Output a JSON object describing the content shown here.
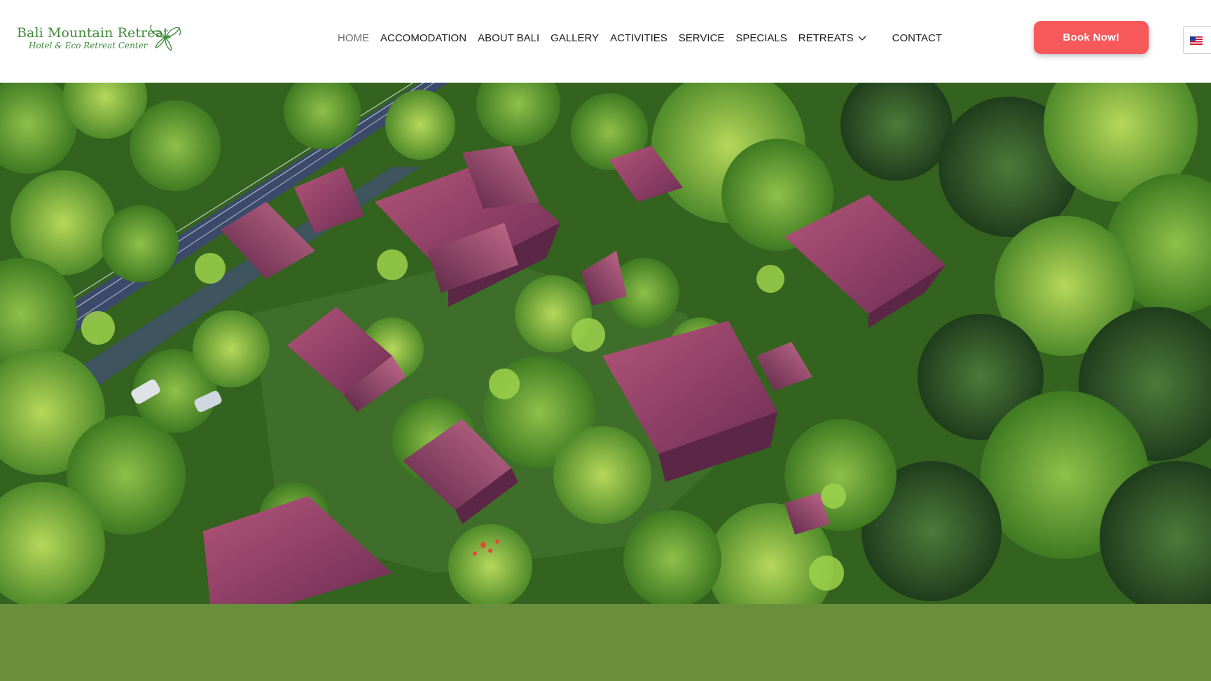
{
  "brand": {
    "name": "Bali Mountain Retreat",
    "tagline": "Hotel & Eco Retreat Center",
    "logo_icon": "orchid-icon",
    "color": "#3e8b3a"
  },
  "nav": {
    "items": [
      {
        "label": "HOME",
        "active": true
      },
      {
        "label": "ACCOMODATION"
      },
      {
        "label": "ABOUT BALI"
      },
      {
        "label": "GALLERY"
      },
      {
        "label": "ACTIVITIES"
      },
      {
        "label": "SERVICE"
      },
      {
        "label": "SPECIALS"
      },
      {
        "label": "RETREATS",
        "has_dropdown": true,
        "dropdown_icon": "chevron-down-icon"
      },
      {
        "label": "CONTACT"
      }
    ]
  },
  "cta": {
    "label": "Book Now!",
    "color": "#f7585a"
  },
  "language": {
    "selected": "en-US",
    "icon": "us-flag-icon"
  },
  "hero": {
    "image": "aerial-view-of-retreat"
  },
  "band": {
    "color": "#6a8f3c"
  }
}
